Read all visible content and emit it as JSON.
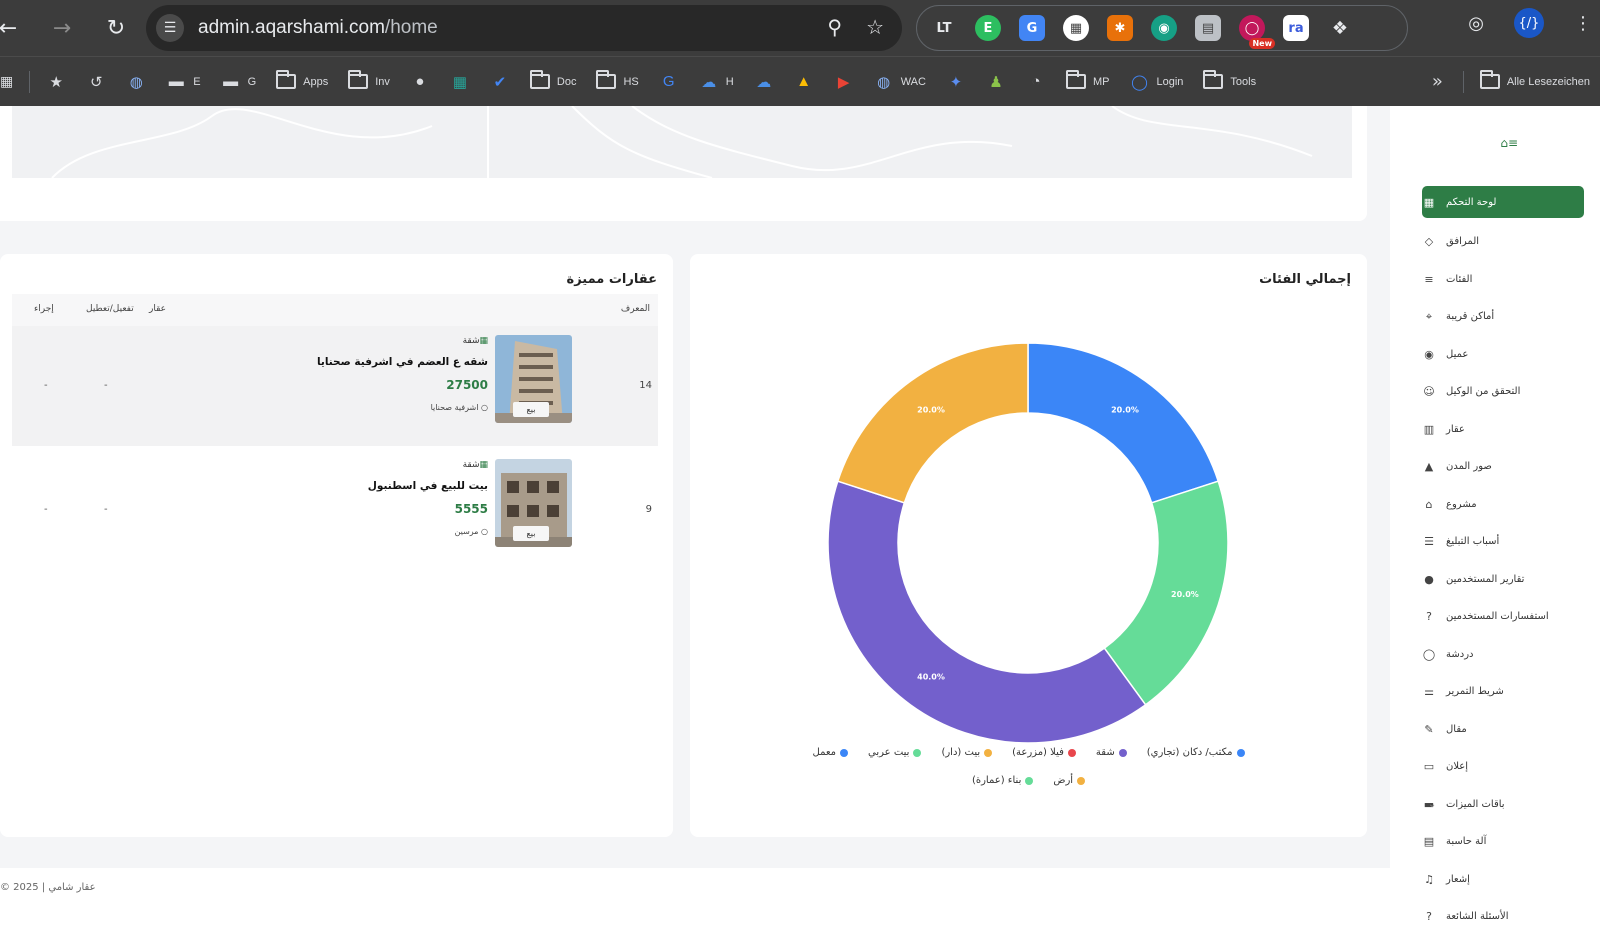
{
  "browser": {
    "url_host": "admin.aqarshami.com",
    "url_path": "/home",
    "new_badge": "New",
    "profile_icon": "code-brackets-icon"
  },
  "bookmarks": [
    {
      "label": "",
      "icon": "star-icon"
    },
    {
      "label": "",
      "icon": "history-icon"
    },
    {
      "label": "",
      "icon": "globe-icon"
    },
    {
      "label": "E",
      "icon": "redacted-icon"
    },
    {
      "label": "G",
      "icon": "redacted-icon"
    },
    {
      "label": "Apps",
      "icon": "folder-icon"
    },
    {
      "label": "Inv",
      "icon": "folder-icon"
    },
    {
      "label": "",
      "icon": "github-icon"
    },
    {
      "label": "",
      "icon": "trello-icon"
    },
    {
      "label": "",
      "icon": "check-icon"
    },
    {
      "label": "Doc",
      "icon": "folder-icon"
    },
    {
      "label": "HS",
      "icon": "folder-icon"
    },
    {
      "label": "",
      "icon": "translate-icon"
    },
    {
      "label": "H",
      "icon": "cloud-icon"
    },
    {
      "label": "",
      "icon": "cloud-icon"
    },
    {
      "label": "",
      "icon": "drive-icon"
    },
    {
      "label": "",
      "icon": "youtube-icon"
    },
    {
      "label": "WAC",
      "icon": "globe-icon"
    },
    {
      "label": "",
      "icon": "sparkle-icon"
    },
    {
      "label": "",
      "icon": "chess-icon"
    },
    {
      "label": "",
      "icon": "clock-icon"
    },
    {
      "label": "MP",
      "icon": "folder-icon"
    },
    {
      "label": "Login",
      "icon": "login-icon"
    },
    {
      "label": "Tools",
      "icon": "folder-icon"
    }
  ],
  "bookmarks_all": "Alle Lesezeichen",
  "sidebar": {
    "items": [
      {
        "label": "لوحة التحكم",
        "icon": "grid-icon",
        "active": true
      },
      {
        "label": "المرافق",
        "icon": "diamond-icon"
      },
      {
        "label": "الفئات",
        "icon": "list-icon"
      },
      {
        "label": "أماكن قريبة",
        "icon": "pin-icon"
      },
      {
        "label": "عميل",
        "icon": "user-circle-icon"
      },
      {
        "label": "التحقق من الوكيل",
        "icon": "user-check-icon",
        "expandable": true
      },
      {
        "label": "عقار",
        "icon": "building-chart-icon"
      },
      {
        "label": "صور المدن",
        "icon": "city-icon"
      },
      {
        "label": "مشروع",
        "icon": "home-outline-icon"
      },
      {
        "label": "أسباب التبليغ",
        "icon": "lines-icon"
      },
      {
        "label": "تقارير المستخدمين",
        "icon": "alert-icon"
      },
      {
        "label": "استفسارات المستخدمين",
        "icon": "question-icon"
      },
      {
        "label": "دردشة",
        "icon": "chat-icon"
      },
      {
        "label": "شريط التمرير",
        "icon": "slider-icon"
      },
      {
        "label": "مقال",
        "icon": "pen-icon"
      },
      {
        "label": "إعلان",
        "icon": "ad-icon"
      },
      {
        "label": "باقات الميزات",
        "icon": "card-icon",
        "expandable": true
      },
      {
        "label": "آلة حاسبة",
        "icon": "calculator-icon"
      },
      {
        "label": "إشعار",
        "icon": "bell-icon"
      },
      {
        "label": "الأسئلة الشائعة",
        "icon": "faq-icon"
      }
    ]
  },
  "featured": {
    "title": "عقارات مميزة",
    "columns": {
      "id": "المعرف",
      "property": "عقار",
      "toggle": "تفعيل/تعطيل",
      "action": "إجراء"
    },
    "rows": [
      {
        "id": "14",
        "category": "شقة",
        "name": "شقه ع العضم في اشرفية صحنايا",
        "price": "27500",
        "location": "اشرفية صحنايا",
        "tag": "بيع",
        "toggle": "-",
        "action": "-"
      },
      {
        "id": "9",
        "category": "شقة",
        "name": "بيت للبيع في اسطنبول",
        "price": "5555",
        "location": "مرسين",
        "tag": "بيع",
        "toggle": "-",
        "action": "-"
      }
    ]
  },
  "chart_card": {
    "title": "إجمالي الفئات"
  },
  "chart_data": {
    "type": "pie",
    "donut": true,
    "slices": [
      {
        "label": "مكتب/ دكان (تجاري)",
        "value": 20.0,
        "color": "#3b86f7"
      },
      {
        "label": "معمل",
        "value": 20.0,
        "color": "#65dc98"
      },
      {
        "label": "شقة",
        "value": 40.0,
        "color": "#7360cc"
      },
      {
        "label": "بيت عربي",
        "value": 20.0,
        "color": "#f2b141"
      }
    ],
    "slice_labels": [
      "20.0%",
      "20.0%",
      "40.0%",
      "20.0%"
    ],
    "legend": [
      {
        "label": "مكتب/ دكان (تجاري)",
        "color": "#3b86f7"
      },
      {
        "label": "شقة",
        "color": "#7360cc"
      },
      {
        "label": "فيلا (مزرعة)",
        "color": "#e8464c"
      },
      {
        "label": "بيت (دار)",
        "color": "#f2b141"
      },
      {
        "label": "بيت عربي",
        "color": "#65dc98"
      },
      {
        "label": "معمل",
        "color": "#3b86f7"
      },
      {
        "label": "أرض",
        "color": "#f2b141"
      },
      {
        "label": "بناء (عمارة)",
        "color": "#65dc98"
      }
    ],
    "legend_placement": "bottom"
  },
  "footer": {
    "text": "© 2025 | عقار شامي"
  }
}
